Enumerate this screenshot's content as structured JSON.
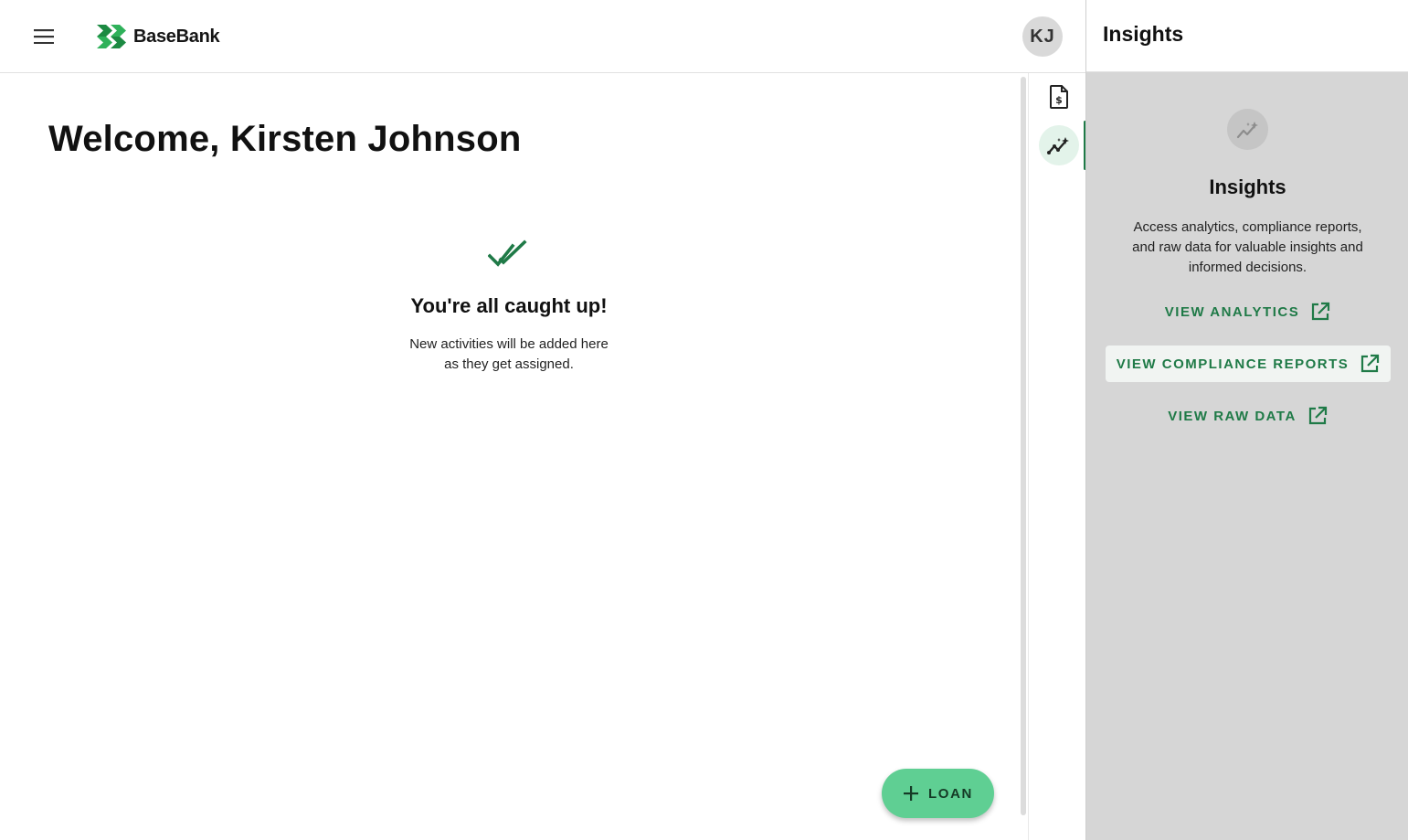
{
  "header": {
    "brand": "BaseBank",
    "avatar_initials": "KJ"
  },
  "main": {
    "welcome": "Welcome, Kirsten Johnson",
    "empty_title": "You're all caught up!",
    "empty_text": "New activities will be added here as they get assigned.",
    "fab_label": "LOAN"
  },
  "rail": {
    "items": [
      {
        "icon": "document-dollar-icon",
        "active": false
      },
      {
        "icon": "insights-sparkle-icon",
        "active": true
      }
    ]
  },
  "panel": {
    "header_title": "Insights",
    "title": "Insights",
    "description": "Access analytics, compliance reports, and raw data for valuable insights and informed decisions.",
    "links": [
      {
        "label": "VIEW ANALYTICS",
        "icon": "external-link-icon"
      },
      {
        "label": "VIEW COMPLIANCE REPORTS",
        "icon": "external-link-icon",
        "highlighted": true
      },
      {
        "label": "VIEW RAW DATA",
        "icon": "external-link-icon"
      }
    ]
  },
  "colors": {
    "brand_green": "#1f7a47",
    "fab_green": "#5fcf93",
    "panel_bg": "#d6d6d6"
  }
}
